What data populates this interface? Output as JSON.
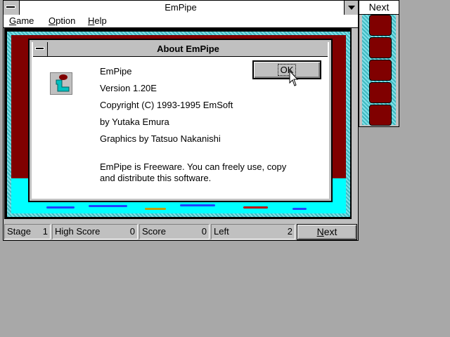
{
  "main_window": {
    "title": "EmPipe",
    "menu": [
      {
        "label": "Game",
        "accel": "G",
        "rest": "ame"
      },
      {
        "label": "Option",
        "accel": "O",
        "rest": "ption"
      },
      {
        "label": "Help",
        "accel": "H",
        "rest": "elp"
      }
    ]
  },
  "status": {
    "stage_label": "Stage",
    "stage_value": "1",
    "high_label": "High Score",
    "high_value": "0",
    "score_label": "Score",
    "score_value": "0",
    "left_label": "Left",
    "left_value": "2",
    "next_button_accel": "N",
    "next_button_rest": "ext"
  },
  "next_window": {
    "title": "Next",
    "slot_count": 5
  },
  "about_dialog": {
    "title": "About EmPipe",
    "ok_label": "OK",
    "lines": {
      "name": "EmPipe",
      "version": "Version 1.20E",
      "copyright": "Copyright (C) 1993-1995 EmSoft",
      "author": "by Yutaka Emura",
      "graphics": "Graphics by Tatsuo Nakanishi",
      "license_1": "EmPipe is Freeware. You can freely use, copy",
      "license_2": "and distribute this software."
    }
  },
  "colors": {
    "desktop": "#a8a8a8",
    "wall": "#800000",
    "water": "#00ffff",
    "face": "#c0c0c0"
  },
  "icons": {
    "app_icon": "pipe-icon",
    "cursor": "arrow-cursor-icon"
  }
}
